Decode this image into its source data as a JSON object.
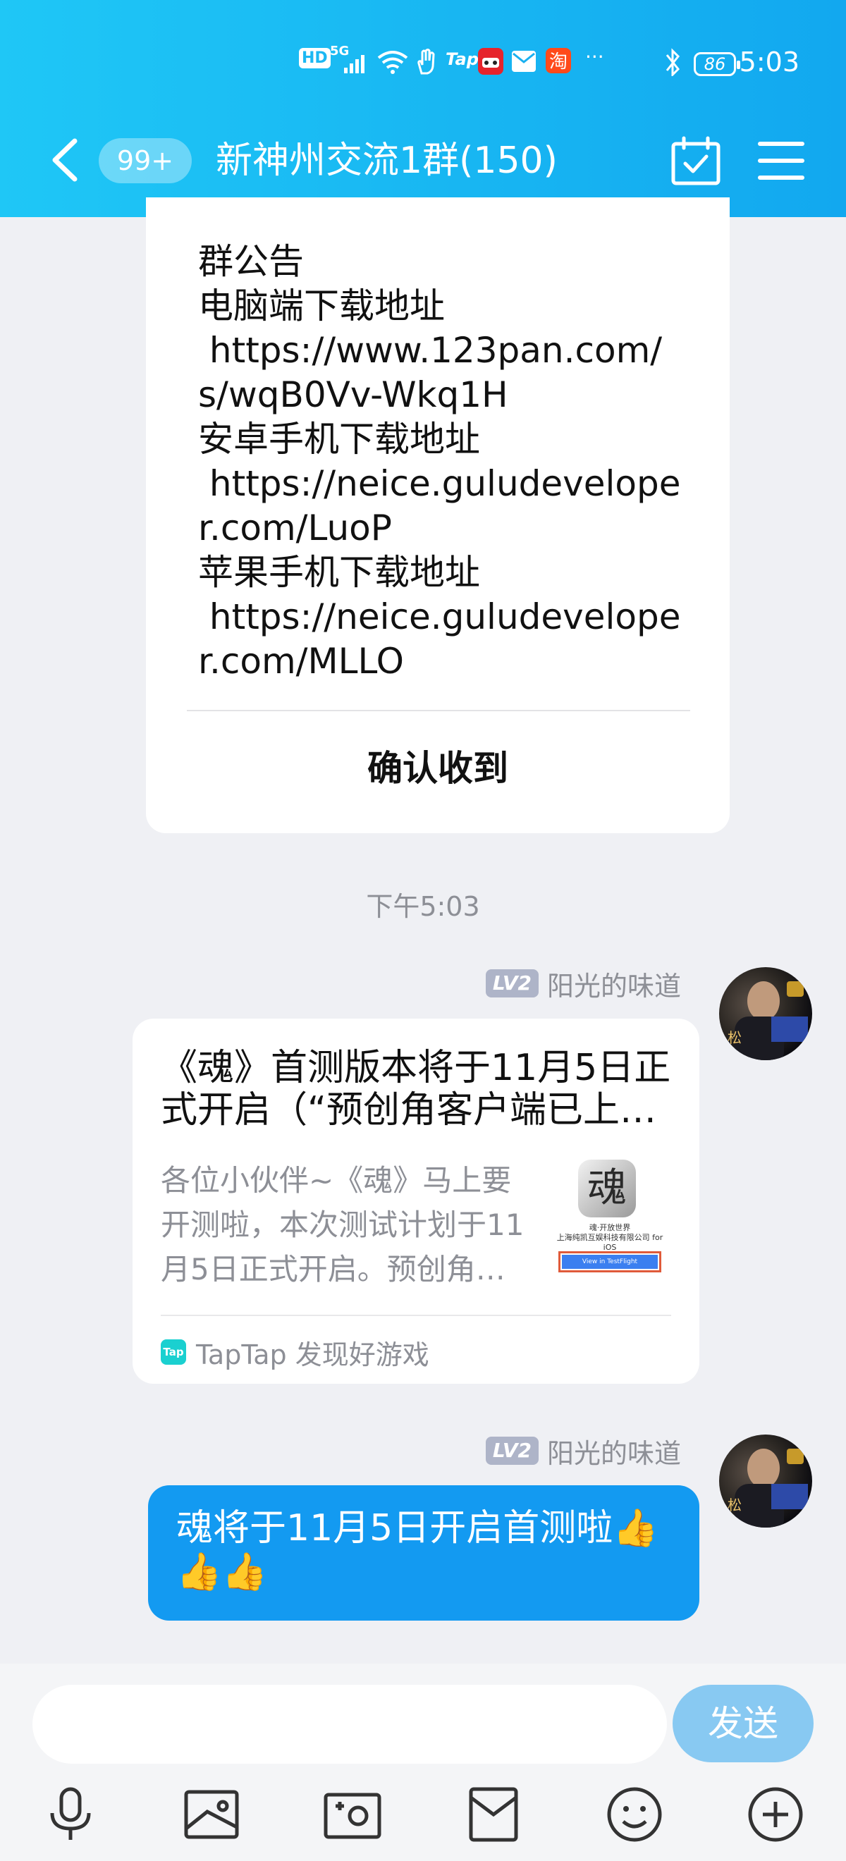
{
  "statusbar": {
    "left_icons": [
      "hd-icon",
      "5g-signal-icon",
      "wifi-icon",
      "hand-gesture-icon",
      "taptap-icon",
      "tmall-icon",
      "mail-notification-icon",
      "taobao-icon",
      "more-dots-icon"
    ],
    "hd": "HD",
    "net": "5G",
    "tap": "Tap",
    "more": "···",
    "battery": "86",
    "time": "5:03"
  },
  "header": {
    "unread_badge": "99+",
    "title": "新神州交流1群(150)"
  },
  "notice": {
    "text": "群公告\n电脑端下载地址\n https://www.123pan.com/s/wqB0Vv-Wkq1H\n安卓手机下载地址\n https://neice.guludeveloper.com/LuoP\n苹果手机下载地址\n https://neice.guludeveloper.com/MLLO",
    "confirm_label": "确认收到"
  },
  "timestamp": "下午5:03",
  "messages": [
    {
      "level": "LV2",
      "sender": "阳光的味道",
      "share": {
        "title": "《魂》首测版本将于11月5日正式开启（“预创角客户端已上线”）",
        "description": "各位小伙伴~《魂》马上要开测啦，本次测试计划于11月5日正式开启。预创角客户端已上线",
        "thumb_icon": "魂",
        "thumb_line1": "魂·开放世界",
        "thumb_line2": "上海纯凯互娱科技有限公司 for iOS",
        "thumb_button": "View in TestFlight",
        "source_logo": "Tap",
        "source": "TapTap 发现好游戏"
      },
      "avatar_char": "松"
    },
    {
      "level": "LV2",
      "sender": "阳光的味道",
      "text": "魂将于11月5日开启首测啦👍👍👍",
      "avatar_char": "松"
    }
  ],
  "input": {
    "placeholder": "",
    "send_label": "发送"
  },
  "toolbar": [
    "microphone-icon",
    "photo-icon",
    "camera-icon",
    "red-packet-icon",
    "emoji-icon",
    "plus-icon"
  ],
  "colors": {
    "header_start": "#1fc7f6",
    "header_end": "#12a8ef",
    "bubble": "#139af1",
    "send_button": "#88c9f2",
    "background": "#eff0f4"
  }
}
